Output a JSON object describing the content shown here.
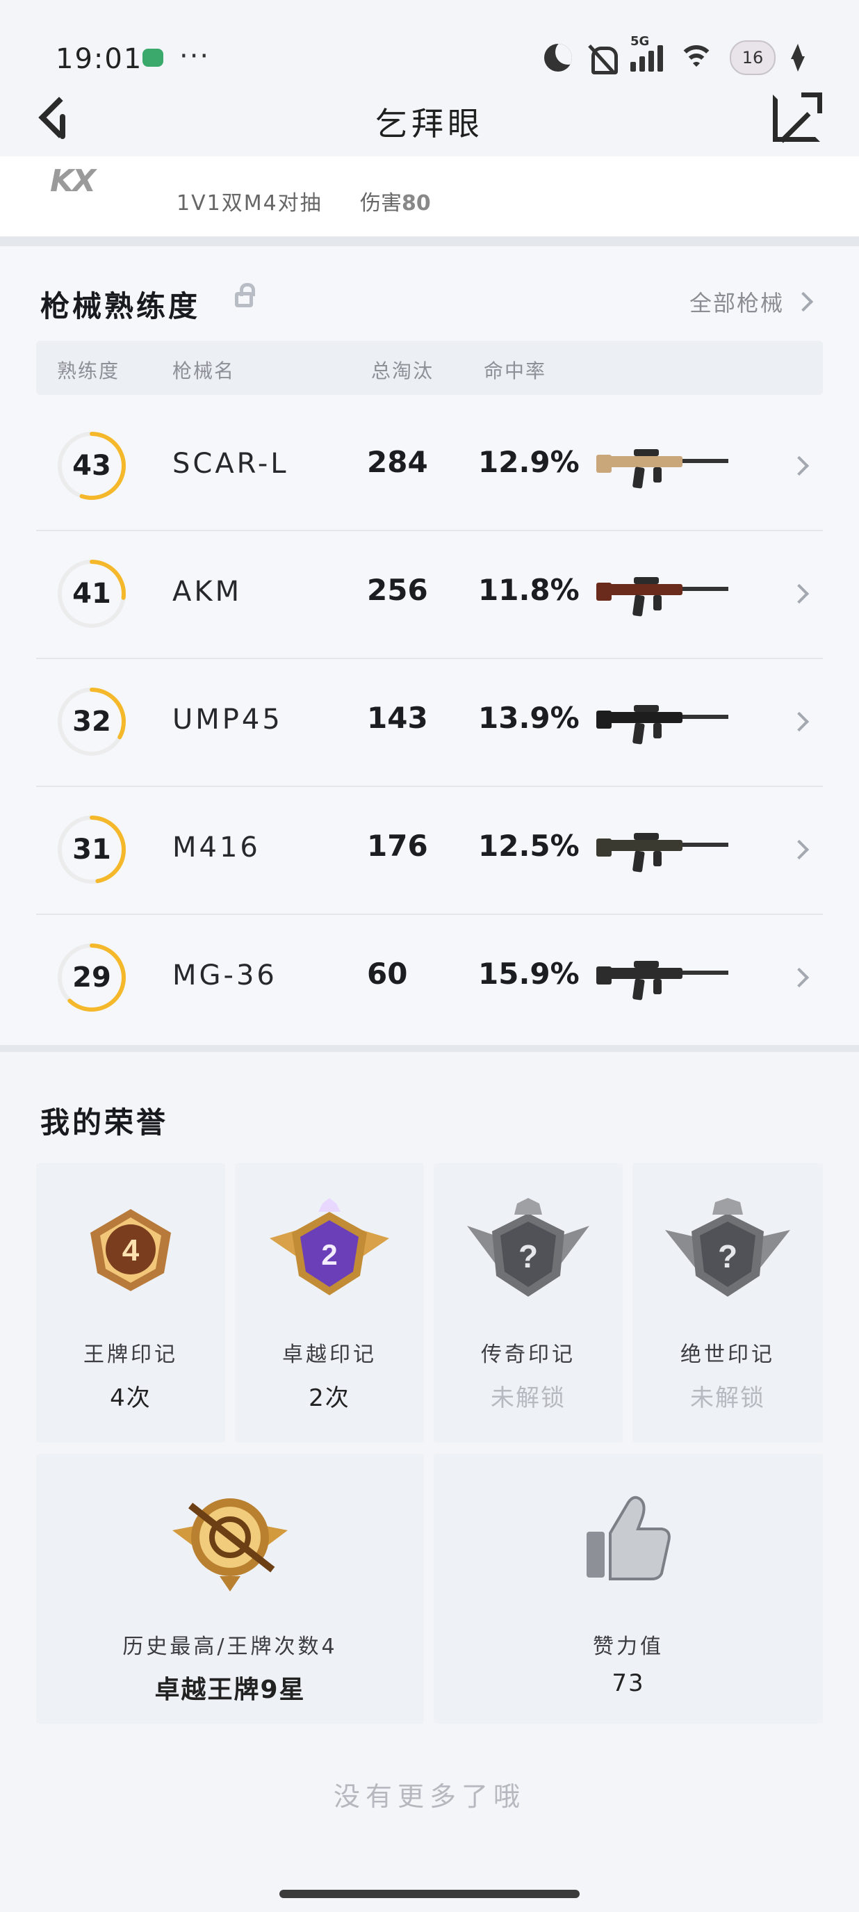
{
  "status_bar": {
    "time": "19:01",
    "dots": "···",
    "network": "5G",
    "battery": "16"
  },
  "nav": {
    "title": "乞拜眼"
  },
  "previous_match": {
    "logo": "KX",
    "mode": "1V1双M4对抽",
    "damage_label": "伤害",
    "damage_value": "80"
  },
  "weapons": {
    "title": "枪械熟练度",
    "all_label": "全部枪械",
    "headers": [
      "熟练度",
      "枪械名",
      "总淘汰",
      "命中率"
    ],
    "rows": [
      {
        "level": "43",
        "name": "SCAR-L",
        "kills": "284",
        "rate": "12.9%",
        "progress": 0.55,
        "color": "#c9a77a"
      },
      {
        "level": "41",
        "name": "AKM",
        "kills": "256",
        "rate": "11.8%",
        "progress": 0.27,
        "color": "#6a2a1c"
      },
      {
        "level": "32",
        "name": "UMP45",
        "kills": "143",
        "rate": "13.9%",
        "progress": 0.33,
        "color": "#1d1d1d"
      },
      {
        "level": "31",
        "name": "M416",
        "kills": "176",
        "rate": "12.5%",
        "progress": 0.47,
        "color": "#3a3a30"
      },
      {
        "level": "29",
        "name": "MG-36",
        "kills": "60",
        "rate": "15.9%",
        "progress": 0.62,
        "color": "#2c2c2c"
      }
    ]
  },
  "honors": {
    "title": "我的荣誉",
    "marks": [
      {
        "badge": "4",
        "label": "王牌印记",
        "value": "4次",
        "locked": false
      },
      {
        "badge": "2",
        "label": "卓越印记",
        "value": "2次",
        "locked": false
      },
      {
        "badge": "?",
        "label": "传奇印记",
        "value": "未解锁",
        "locked": true
      },
      {
        "badge": "?",
        "label": "绝世印记",
        "value": "未解锁",
        "locked": true
      }
    ],
    "rank": {
      "label": "历史最高/王牌次数4",
      "value": "卓越王牌9星"
    },
    "likes": {
      "label": "赞力值",
      "value": "73"
    }
  },
  "footer": {
    "no_more": "没有更多了哦"
  },
  "colors": {
    "accent_ring": "#f5b82a",
    "ring_track": "#ececec"
  }
}
